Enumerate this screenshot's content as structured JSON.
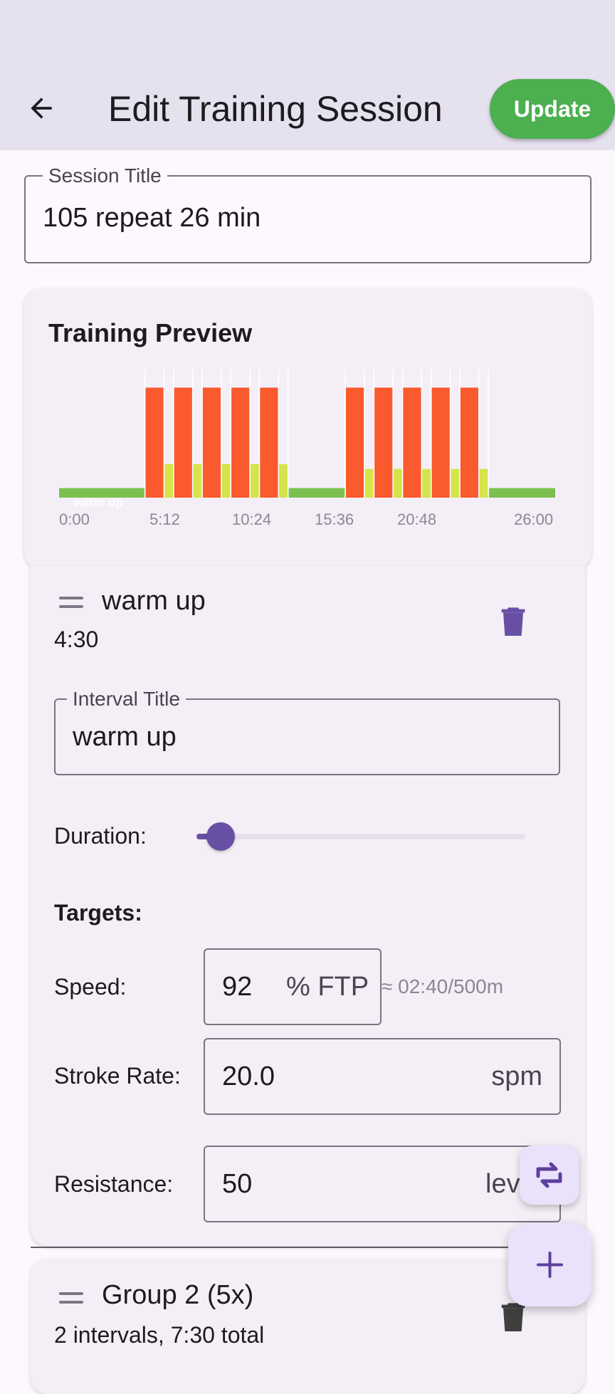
{
  "app": {
    "title": "Edit Training Session",
    "back_icon": "arrow-left-icon",
    "update_label": "Update"
  },
  "colors": {
    "appbar": "#e6e1ef",
    "background": "#fdf8fd",
    "accent": "#6750a4",
    "update": "#4caf50",
    "bar_orange": "#fa5a2d",
    "bar_yellow": "#d4e44a",
    "bar_green": "#7cc14f"
  },
  "session": {
    "label": "Session Title",
    "value": "105 repeat 26 min"
  },
  "preview": {
    "title": "Training Preview",
    "annotation": "warm up",
    "x_ticks": [
      "0:00",
      "5:12",
      "10:24",
      "15:36",
      "20:48",
      "26:00"
    ]
  },
  "interval": {
    "title": "warm up",
    "duration": "4:30",
    "field_label": "Interval Title",
    "field_value": "warm up",
    "duration_label": "Duration:",
    "duration_slider_value": 0.06,
    "targets_label": "Targets:",
    "speed_label": "Speed:",
    "speed_value": "92",
    "speed_unit": "% FTP",
    "pace": "≈ 02:40/500m",
    "stroke_label": "Stroke Rate:",
    "stroke_value": "20.0",
    "stroke_unit": "spm",
    "resistance_label": "Resistance:",
    "resistance_value": "50",
    "resistance_unit": "lev"
  },
  "group": {
    "title": "Group 2 (5x)",
    "summary": "2 intervals, 7:30 total"
  },
  "fab": {
    "small_icon": "repeat-arrows-icon",
    "large_icon": "plus-icon"
  },
  "chart_data": {
    "type": "bar",
    "title": "Training Preview",
    "xlabel": "",
    "ylabel": "",
    "x_ticks": [
      "0:00",
      "5:12",
      "10:24",
      "15:36",
      "20:48",
      "26:00"
    ],
    "segments": [
      {
        "start": 0.0,
        "end": 4.5,
        "kind": "green",
        "value": 0.08
      },
      {
        "start": 4.5,
        "end": 5.5,
        "kind": "orange",
        "value": 0.92
      },
      {
        "start": 5.5,
        "end": 6.0,
        "kind": "yellow",
        "value": 0.28
      },
      {
        "start": 6.0,
        "end": 7.0,
        "kind": "orange",
        "value": 0.92
      },
      {
        "start": 7.0,
        "end": 7.5,
        "kind": "yellow",
        "value": 0.28
      },
      {
        "start": 7.5,
        "end": 8.5,
        "kind": "orange",
        "value": 0.92
      },
      {
        "start": 8.5,
        "end": 9.0,
        "kind": "yellow",
        "value": 0.28
      },
      {
        "start": 9.0,
        "end": 10.0,
        "kind": "orange",
        "value": 0.92
      },
      {
        "start": 10.0,
        "end": 10.5,
        "kind": "yellow",
        "value": 0.28
      },
      {
        "start": 10.5,
        "end": 11.5,
        "kind": "orange",
        "value": 0.92
      },
      {
        "start": 11.5,
        "end": 12.0,
        "kind": "yellow",
        "value": 0.28
      },
      {
        "start": 12.0,
        "end": 15.0,
        "kind": "green",
        "value": 0.08
      },
      {
        "start": 15.0,
        "end": 16.0,
        "kind": "orange",
        "value": 0.92
      },
      {
        "start": 16.0,
        "end": 16.5,
        "kind": "yellow",
        "value": 0.24
      },
      {
        "start": 16.5,
        "end": 17.5,
        "kind": "orange",
        "value": 0.92
      },
      {
        "start": 17.5,
        "end": 18.0,
        "kind": "yellow",
        "value": 0.24
      },
      {
        "start": 18.0,
        "end": 19.0,
        "kind": "orange",
        "value": 0.92
      },
      {
        "start": 19.0,
        "end": 19.5,
        "kind": "yellow",
        "value": 0.24
      },
      {
        "start": 19.5,
        "end": 20.5,
        "kind": "orange",
        "value": 0.92
      },
      {
        "start": 20.5,
        "end": 21.0,
        "kind": "yellow",
        "value": 0.24
      },
      {
        "start": 21.0,
        "end": 22.0,
        "kind": "orange",
        "value": 0.92
      },
      {
        "start": 22.0,
        "end": 22.5,
        "kind": "yellow",
        "value": 0.24
      },
      {
        "start": 22.5,
        "end": 26.0,
        "kind": "green",
        "value": 0.08
      }
    ],
    "interval_markers": [
      4.5,
      5.5,
      6.0,
      7.0,
      7.5,
      8.5,
      9.0,
      10.0,
      10.5,
      11.5,
      12.0,
      15.0,
      16.0,
      16.5,
      17.5,
      18.0,
      19.0,
      19.5,
      20.5,
      21.0,
      22.0,
      22.5
    ]
  }
}
